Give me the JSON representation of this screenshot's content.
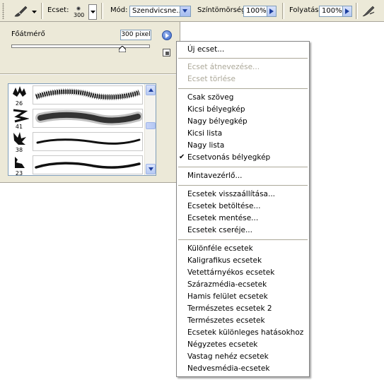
{
  "toolbar": {
    "brush_label": "Ecset:",
    "brush_size": "300",
    "mode_label": "Mód:",
    "mode_value": "Szendvicsne...",
    "opacity_label": "Színtömörség:",
    "opacity_value": "100%",
    "flow_label": "Folyatás:",
    "flow_value": "100%"
  },
  "panel": {
    "master_diameter_label": "Főátmérő",
    "master_diameter_value": "300 pixel",
    "slider_fraction": 0.8,
    "brushes": [
      {
        "size": "26"
      },
      {
        "size": "41"
      },
      {
        "size": "38"
      },
      {
        "size": "23"
      }
    ]
  },
  "menu": {
    "items": [
      {
        "label": "Új ecset...",
        "disabled": false
      },
      {
        "label": "Ecset átnevezése...",
        "disabled": true
      },
      {
        "label": "Ecset törlése",
        "disabled": true
      },
      {
        "label": "Csak szöveg",
        "disabled": false
      },
      {
        "label": "Kicsi bélyegkép",
        "disabled": false
      },
      {
        "label": "Nagy bélyegkép",
        "disabled": false
      },
      {
        "label": "Kicsi lista",
        "disabled": false
      },
      {
        "label": "Nagy lista",
        "disabled": false
      },
      {
        "label": "Ecsetvonás bélyegkép",
        "disabled": false,
        "checked": true
      },
      {
        "label": "Mintavezérlő...",
        "disabled": false
      },
      {
        "label": "Ecsetek visszaállítása...",
        "disabled": false
      },
      {
        "label": "Ecsetek betöltése...",
        "disabled": false
      },
      {
        "label": "Ecsetek mentése...",
        "disabled": false
      },
      {
        "label": "Ecsetek cseréje...",
        "disabled": false
      },
      {
        "label": "Különféle ecsetek",
        "disabled": false
      },
      {
        "label": "Kaligrafikus ecsetek",
        "disabled": false
      },
      {
        "label": "Vetettárnyékos ecsetek",
        "disabled": false
      },
      {
        "label": "Szárazmédia-ecsetek",
        "disabled": false
      },
      {
        "label": "Hamis felület ecsetek",
        "disabled": false
      },
      {
        "label": "Természetes ecsetek 2",
        "disabled": false
      },
      {
        "label": "Természetes ecsetek",
        "disabled": false
      },
      {
        "label": "Ecsetek különleges hatásokhoz",
        "disabled": false
      },
      {
        "label": "Négyzetes ecsetek",
        "disabled": false
      },
      {
        "label": "Vastag nehéz ecsetek",
        "disabled": false
      },
      {
        "label": "Nedvesmédia-ecsetek",
        "disabled": false
      }
    ]
  }
}
